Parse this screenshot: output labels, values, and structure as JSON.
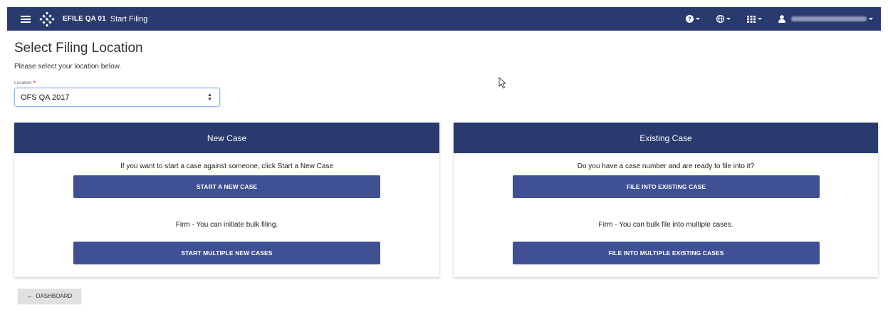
{
  "header": {
    "brand": "EFILE QA 01",
    "page_title": "Start Filing",
    "menus": [
      {
        "icon": "help-icon"
      },
      {
        "icon": "globe-icon"
      },
      {
        "icon": "apps-grid-icon"
      },
      {
        "icon": "user-icon"
      }
    ]
  },
  "page": {
    "title": "Select Filing Location",
    "subtitle": "Please select your location below.",
    "location_label": "Location",
    "required_mark": "*",
    "location_value": "OFS QA 2017"
  },
  "new_case": {
    "title": "New Case",
    "message_1": "If you want to start a case against someone, click Start a New Case",
    "button_1": "START A NEW CASE",
    "message_2": "Firm - You can initiate bulk filing.",
    "button_2": "START MULTIPLE NEW CASES"
  },
  "existing_case": {
    "title": "Existing Case",
    "message_1": "Do you have a case number and are ready to file into it?",
    "button_1": "FILE INTO EXISTING CASE",
    "message_2": "Firm - You can bulk file into multiple cases.",
    "button_2": "FILE INTO MULTIPLE EXISTING CASES"
  },
  "footer": {
    "dashboard_label": "DASHBOARD"
  },
  "colors": {
    "header_bg": "#283a6e",
    "button_bg": "#3f5194",
    "required": "#e53935"
  }
}
